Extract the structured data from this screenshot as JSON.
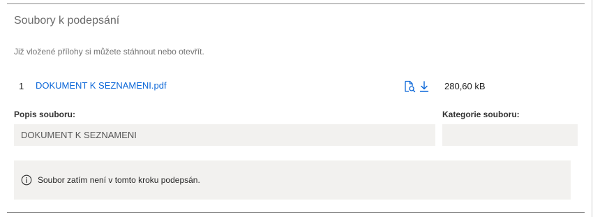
{
  "section": {
    "title": "Soubory k podepsání",
    "subtitle": "Již vložené přílohy si můžete stáhnout nebo otevřít."
  },
  "files": [
    {
      "index": "1",
      "name": "DOKUMENT K SEZNAMENI.pdf",
      "size": "280,60 kB",
      "actions": [
        {
          "icon": "file-preview-icon"
        },
        {
          "icon": "download-icon"
        }
      ],
      "description_label": "Popis souboru:",
      "description_value": "DOKUMENT K SEZNAMENI",
      "category_label": "Kategorie souboru:",
      "category_value": ""
    }
  ],
  "info": {
    "icon": "info-icon",
    "text": "Soubor zatím není v tomto kroku podepsán."
  },
  "colors": {
    "link": "#0a66d8",
    "field_bg": "#f2f1ef",
    "rule": "#8a8a8a"
  }
}
